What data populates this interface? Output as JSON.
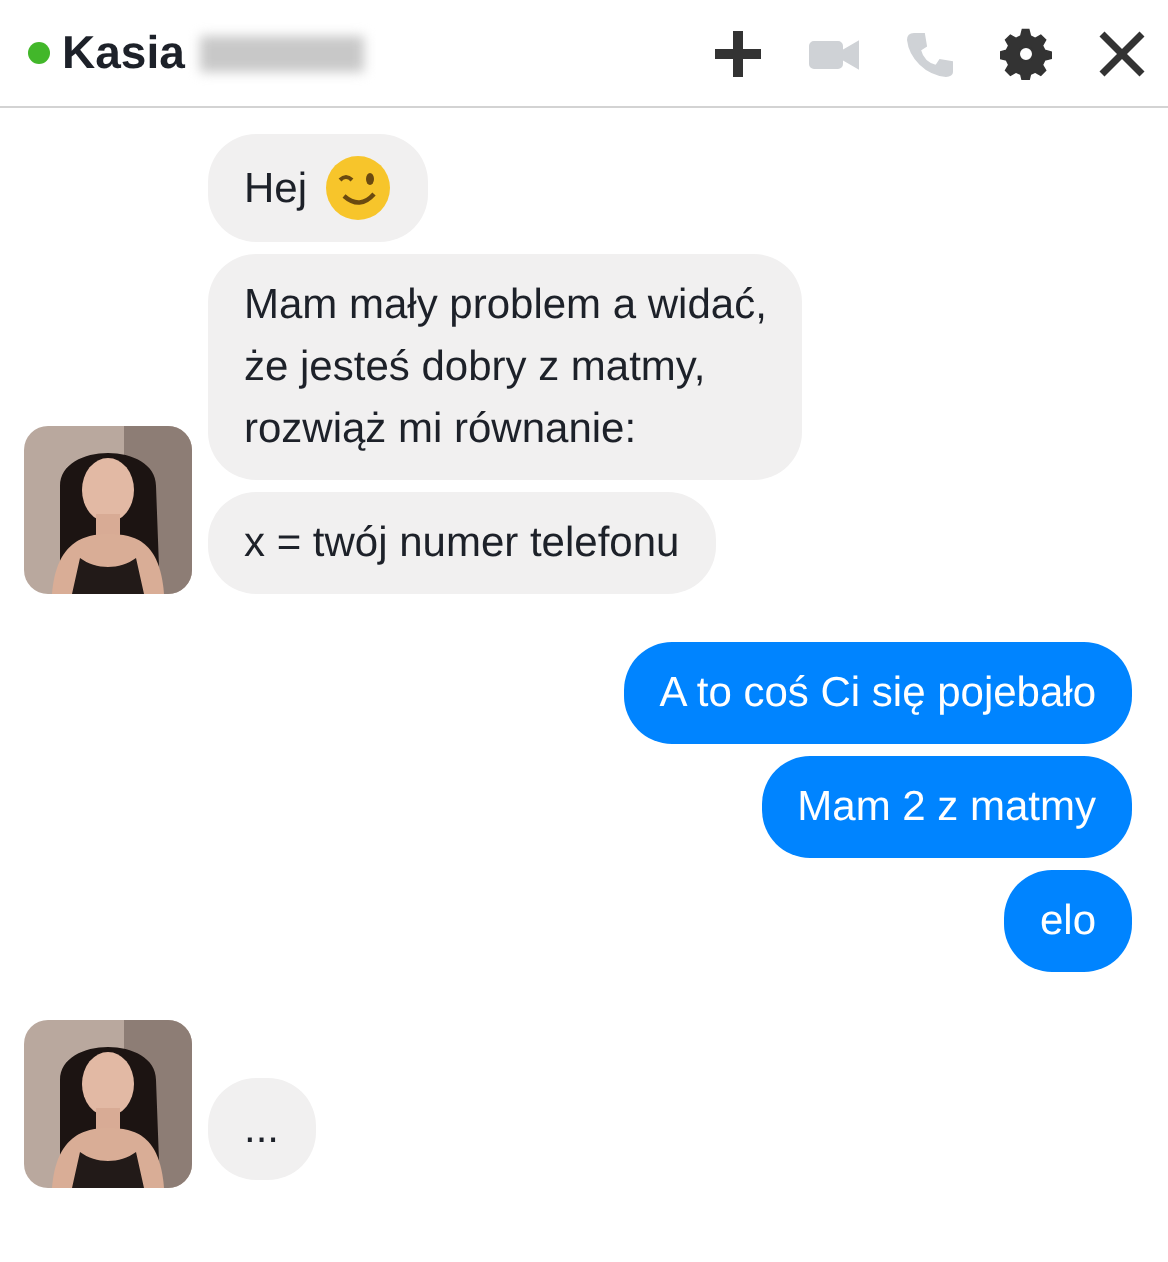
{
  "header": {
    "online": true,
    "name": "Kasia",
    "name_redacted": true,
    "actions": [
      {
        "kind": "add",
        "disabled": false
      },
      {
        "kind": "video",
        "disabled": true
      },
      {
        "kind": "call",
        "disabled": true
      },
      {
        "kind": "settings",
        "disabled": false
      },
      {
        "kind": "close",
        "disabled": false
      }
    ]
  },
  "groups": [
    {
      "kind": "received",
      "messages": [
        {
          "kind": "text_emoji",
          "text": "Hej"
        },
        {
          "kind": "text",
          "text": "Mam mały problem a widać,\nże jesteś dobry z matmy,\nrozwiąż mi równanie:"
        },
        {
          "kind": "text",
          "text": "x = twój numer telefonu"
        }
      ]
    },
    {
      "kind": "sent",
      "messages": [
        {
          "kind": "text",
          "text": "A to coś Ci się pojebało"
        },
        {
          "kind": "text",
          "text": "Mam 2 z matmy"
        },
        {
          "kind": "text",
          "text": "elo"
        }
      ]
    },
    {
      "kind": "received",
      "messages": [
        {
          "kind": "text",
          "text": "..."
        }
      ]
    }
  ]
}
